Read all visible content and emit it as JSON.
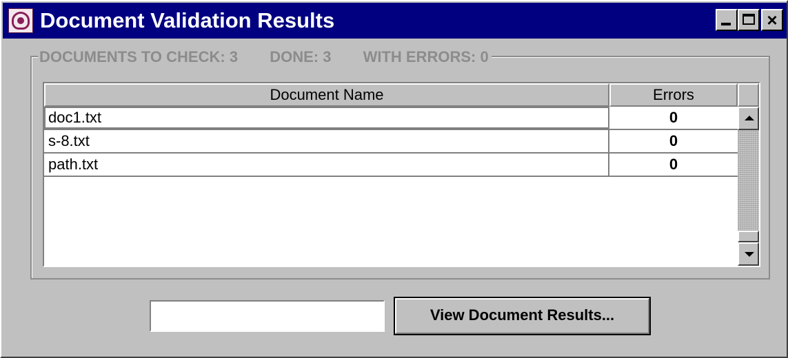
{
  "window": {
    "title": "Document Validation Results",
    "title_bar_color": "#000080",
    "controls": {
      "minimize_icon": "minimize-icon",
      "maximize_icon": "maximize-icon",
      "close_icon": "close-icon",
      "close_glyph": "×"
    }
  },
  "summary": {
    "to_check": "DOCUMENTS TO CHECK: 3",
    "done": "DONE: 3",
    "with_errors": "WITH ERRORS: 0"
  },
  "table": {
    "columns": [
      "Document Name",
      "Errors"
    ],
    "rows": [
      {
        "name": "doc1.txt",
        "errors": "0"
      },
      {
        "name": "s-8.txt",
        "errors": "0"
      },
      {
        "name": "path.txt",
        "errors": "0"
      }
    ]
  },
  "footer": {
    "input_value": "",
    "view_button_label": "View Document Results..."
  }
}
